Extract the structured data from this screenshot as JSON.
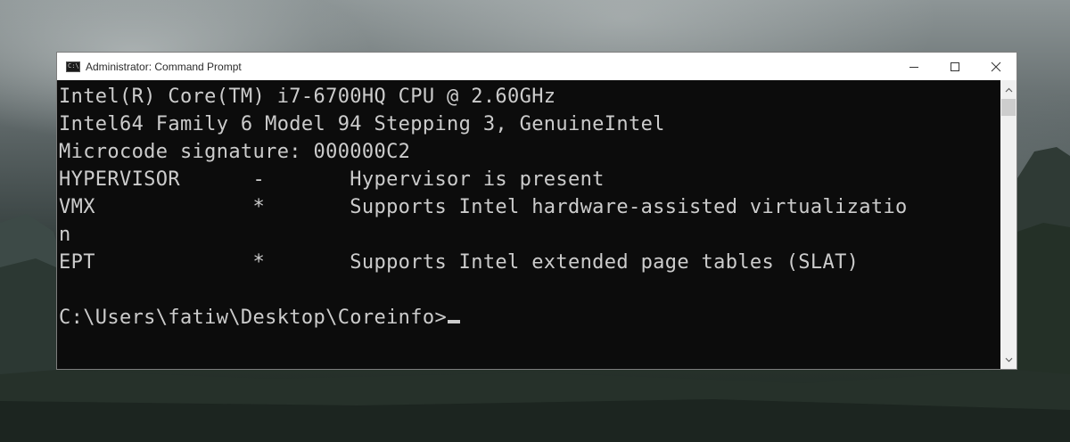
{
  "window": {
    "title": "Administrator: Command Prompt",
    "icon_label": "C:\\"
  },
  "controls": {
    "minimize": "minimize-icon",
    "maximize": "maximize-icon",
    "close": "close-icon"
  },
  "console": {
    "lines": [
      "Intel(R) Core(TM) i7-6700HQ CPU @ 2.60GHz",
      "Intel64 Family 6 Model 94 Stepping 3, GenuineIntel",
      "Microcode signature: 000000C2",
      "HYPERVISOR      -       Hypervisor is present",
      "VMX             *       Supports Intel hardware-assisted virtualizatio",
      "n",
      "EPT             *       Supports Intel extended page tables (SLAT)",
      "",
      "C:\\Users\\fatiw\\Desktop\\Coreinfo>"
    ]
  },
  "scrollbar": {
    "up": "scroll-up-arrow-icon",
    "down": "scroll-down-arrow-icon"
  }
}
